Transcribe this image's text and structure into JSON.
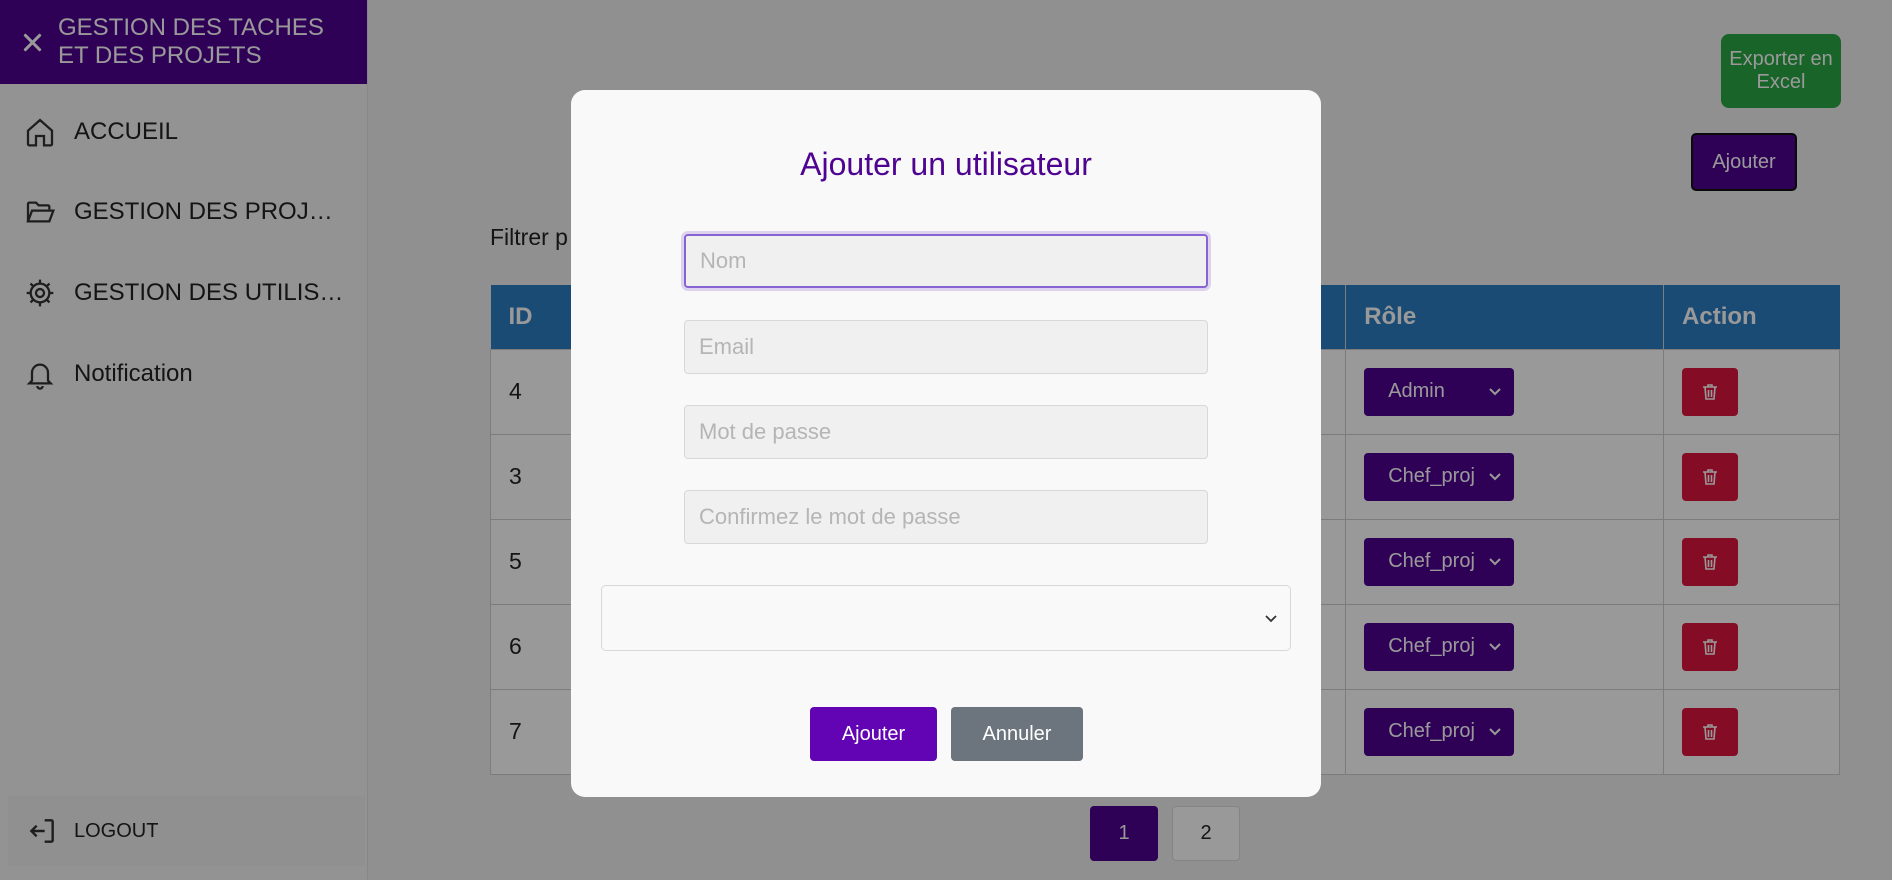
{
  "sidebar": {
    "title": "GESTION DES TACHES ET DES PROJETS",
    "items": [
      {
        "label": "ACCUEIL",
        "icon": "home-icon"
      },
      {
        "label": "GESTION DES PROJETS",
        "icon": "folder-open-icon"
      },
      {
        "label": "GESTION DES UTILISATEURS",
        "icon": "gear-icon"
      },
      {
        "label": "Notification",
        "icon": "bell-icon"
      }
    ],
    "logout": "LOGOUT"
  },
  "toolbar": {
    "export_label": "Exporter en Excel",
    "add_label": "Ajouter"
  },
  "filter": {
    "label": "Filtrer p"
  },
  "table": {
    "columns": [
      "ID",
      "Rôle",
      "Action"
    ],
    "rows": [
      {
        "id": "4",
        "role": "Admin"
      },
      {
        "id": "3",
        "role": "Chef_projet"
      },
      {
        "id": "5",
        "role": "Chef_projet"
      },
      {
        "id": "6",
        "role": "Chef_projet"
      },
      {
        "id": "7",
        "role": "Chef_projet"
      }
    ]
  },
  "pagination": {
    "pages": [
      "1",
      "2"
    ],
    "current": "1"
  },
  "modal": {
    "title": "Ajouter un utilisateur",
    "fields": {
      "name_placeholder": "Nom",
      "email_placeholder": "Email",
      "password_placeholder": "Mot de passe",
      "confirm_placeholder": "Confirmez le mot de passe"
    },
    "role_selected": "",
    "submit_label": "Ajouter",
    "cancel_label": "Annuler"
  },
  "colors": {
    "brand": "#4e0391",
    "table_header": "#2c7ec4",
    "export": "#28a745",
    "delete": "#dc143c"
  }
}
